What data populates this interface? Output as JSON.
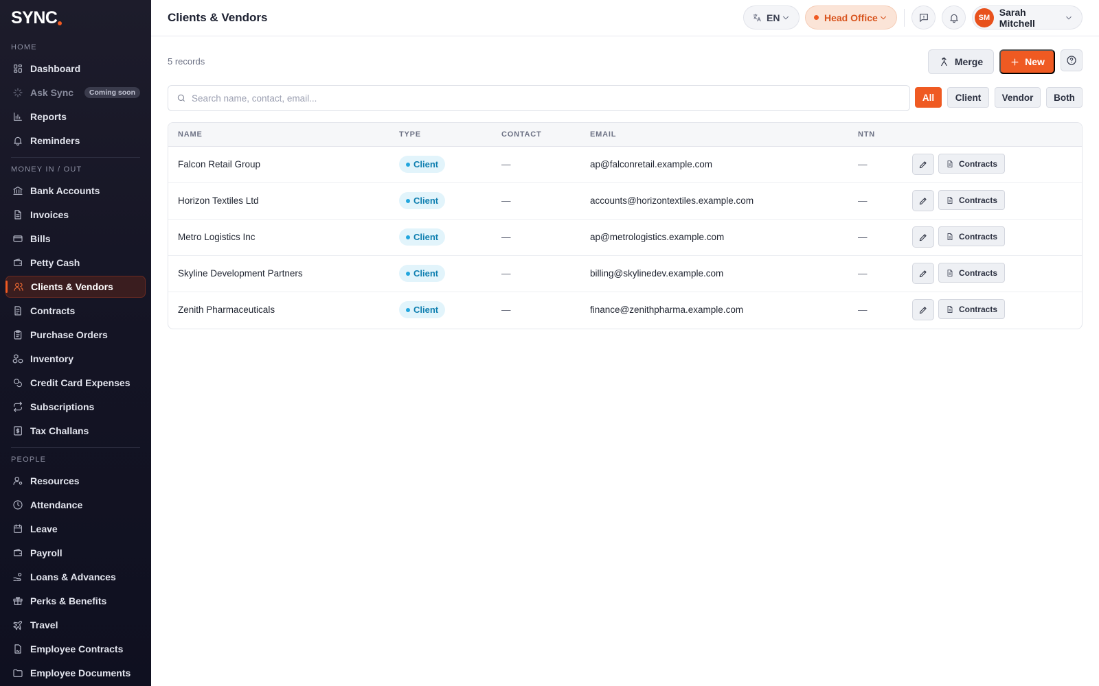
{
  "brand": {
    "name": "SYNC",
    "accent": "#f05a22"
  },
  "sidebar": {
    "sections": [
      {
        "label": "HOME",
        "items": [
          {
            "label": "Dashboard",
            "icon": "dashboard-icon"
          },
          {
            "label": "Ask Sync",
            "icon": "sparkle-icon",
            "badge": "Coming soon",
            "disabled": true
          },
          {
            "label": "Reports",
            "icon": "bar-chart-icon"
          },
          {
            "label": "Reminders",
            "icon": "bell-icon"
          }
        ]
      },
      {
        "label": "MONEY IN / OUT",
        "items": [
          {
            "label": "Bank Accounts",
            "icon": "bank-icon"
          },
          {
            "label": "Invoices",
            "icon": "document-icon"
          },
          {
            "label": "Bills",
            "icon": "receipt-icon"
          },
          {
            "label": "Petty Cash",
            "icon": "wallet-icon"
          },
          {
            "label": "Clients & Vendors",
            "icon": "users-icon",
            "active": true
          },
          {
            "label": "Contracts",
            "icon": "contract-icon"
          },
          {
            "label": "Purchase Orders",
            "icon": "clipboard-icon"
          },
          {
            "label": "Inventory",
            "icon": "boxes-icon"
          },
          {
            "label": "Credit Card Expenses",
            "icon": "coins-icon"
          },
          {
            "label": "Subscriptions",
            "icon": "repeat-icon"
          },
          {
            "label": "Tax Challans",
            "icon": "tax-icon"
          }
        ]
      },
      {
        "label": "PEOPLE",
        "items": [
          {
            "label": "Resources",
            "icon": "user-cog-icon"
          },
          {
            "label": "Attendance",
            "icon": "clock-icon"
          },
          {
            "label": "Leave",
            "icon": "calendar-icon"
          },
          {
            "label": "Payroll",
            "icon": "wallet-icon"
          },
          {
            "label": "Loans & Advances",
            "icon": "hand-coins-icon"
          },
          {
            "label": "Perks & Benefits",
            "icon": "gift-icon"
          },
          {
            "label": "Travel",
            "icon": "plane-icon"
          },
          {
            "label": "Employee Contracts",
            "icon": "file-signature-icon"
          },
          {
            "label": "Employee Documents",
            "icon": "folder-icon"
          }
        ]
      }
    ]
  },
  "header": {
    "title": "Clients & Vendors",
    "language": "EN",
    "office": "Head Office",
    "user": {
      "initials": "SM",
      "name": "Sarah Mitchell"
    }
  },
  "toolbar": {
    "records": "5 records",
    "merge_label": "Merge",
    "new_label": "New"
  },
  "search": {
    "placeholder": "Search name, contact, email..."
  },
  "filters": [
    {
      "label": "All",
      "active": true
    },
    {
      "label": "Client"
    },
    {
      "label": "Vendor"
    },
    {
      "label": "Both"
    }
  ],
  "table": {
    "columns": [
      "NAME",
      "TYPE",
      "CONTACT",
      "EMAIL",
      "NTN"
    ],
    "action_label": "Contracts",
    "rows": [
      {
        "name": "Falcon Retail Group",
        "type": "Client",
        "contact": "—",
        "email": "ap@falconretail.example.com",
        "ntn": "—"
      },
      {
        "name": "Horizon Textiles Ltd",
        "type": "Client",
        "contact": "—",
        "email": "accounts@horizontextiles.example.com",
        "ntn": "—"
      },
      {
        "name": "Metro Logistics Inc",
        "type": "Client",
        "contact": "—",
        "email": "ap@metrologistics.example.com",
        "ntn": "—"
      },
      {
        "name": "Skyline Development Partners",
        "type": "Client",
        "contact": "—",
        "email": "billing@skylinedev.example.com",
        "ntn": "—"
      },
      {
        "name": "Zenith Pharmaceuticals",
        "type": "Client",
        "contact": "—",
        "email": "finance@zenithpharma.example.com",
        "ntn": "—"
      }
    ]
  }
}
